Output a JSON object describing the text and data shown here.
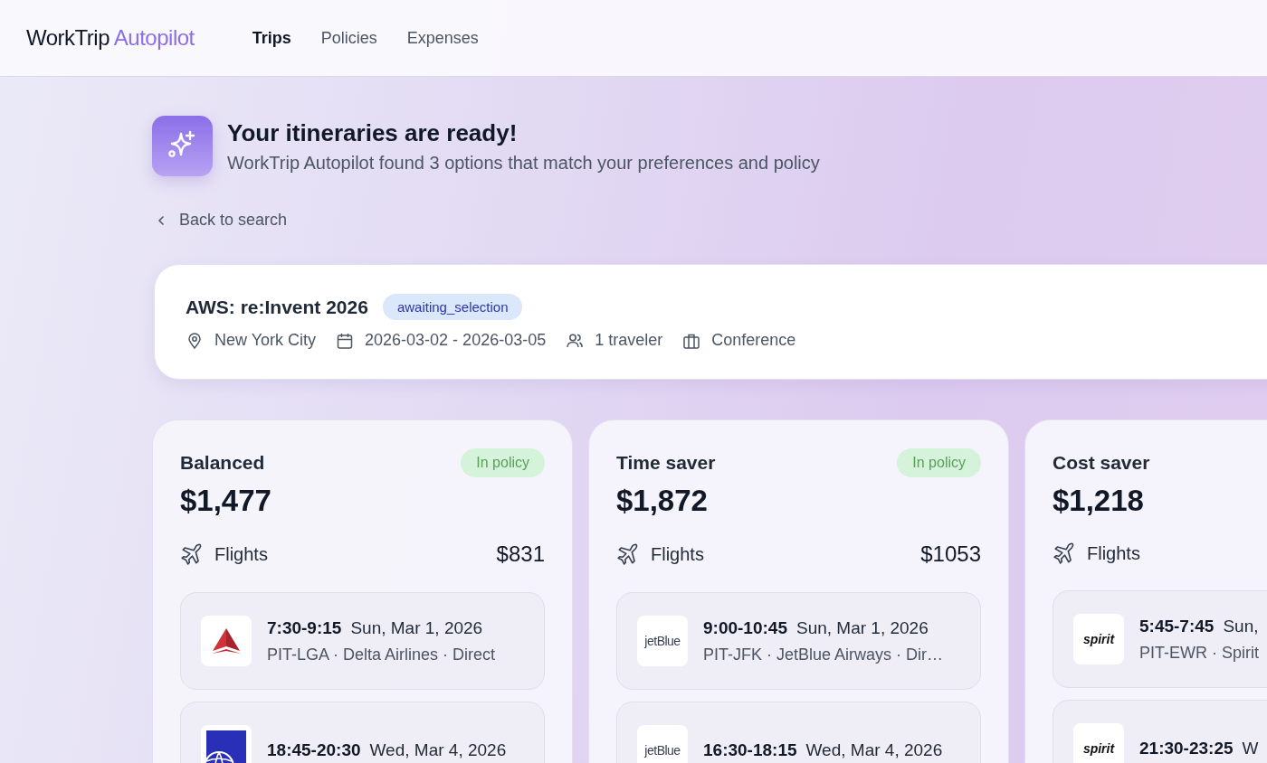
{
  "brand": {
    "name": "WorkTrip",
    "accent": "Autopilot"
  },
  "nav": [
    {
      "label": "Trips",
      "selected": true
    },
    {
      "label": "Policies",
      "selected": false
    },
    {
      "label": "Expenses",
      "selected": false
    }
  ],
  "header": {
    "title": "Your itineraries are ready!",
    "subtitle": "WorkTrip Autopilot found 3 options that match your preferences and policy"
  },
  "back_link": "Back to search",
  "trip": {
    "name": "AWS: re:Invent 2026",
    "status": "awaiting_selection",
    "details": [
      {
        "kind": "location",
        "text": "New York City"
      },
      {
        "kind": "dates",
        "text": "2026-03-02 - 2026-03-05"
      },
      {
        "kind": "travelers",
        "text": "1 traveler"
      },
      {
        "kind": "purpose",
        "text": "Conference"
      }
    ]
  },
  "options": [
    {
      "label": "Balanced",
      "badge": "In policy",
      "total": "$1,477",
      "flights": {
        "label": "Flights",
        "price": "$831",
        "legs": [
          {
            "kind": "delta",
            "times": "7:30-9:15",
            "date": "Sun, Mar 1, 2026",
            "route": "PIT-LGA · Delta Airlines · Direct"
          },
          {
            "kind": "united",
            "times": "18:45-20:30",
            "date": "Wed, Mar 4, 2026"
          }
        ]
      }
    },
    {
      "label": "Time saver",
      "badge": "In policy",
      "total": "$1,872",
      "flights": {
        "label": "Flights",
        "price": "$1053",
        "legs": [
          {
            "kind": "jetblue",
            "logo_text": "jetBlue",
            "times": "9:00-10:45",
            "date": "Sun, Mar 1, 2026",
            "route": "PIT-JFK · JetBlue Airways · Dir…"
          },
          {
            "kind": "jetblue",
            "logo_text": "jetBlue",
            "times": "16:30-18:15",
            "date": "Wed, Mar 4, 2026"
          }
        ]
      }
    },
    {
      "label": "Cost saver",
      "total": "$1,218",
      "flights": {
        "label": "Flights",
        "legs": [
          {
            "kind": "spirit",
            "logo_text": "spirit",
            "times": "5:45-7:45",
            "date": "Sun,",
            "route": "PIT-EWR · Spirit"
          },
          {
            "kind": "spirit",
            "logo_text": "spirit",
            "times": "21:30-23:25",
            "date": "W"
          }
        ]
      }
    }
  ]
}
